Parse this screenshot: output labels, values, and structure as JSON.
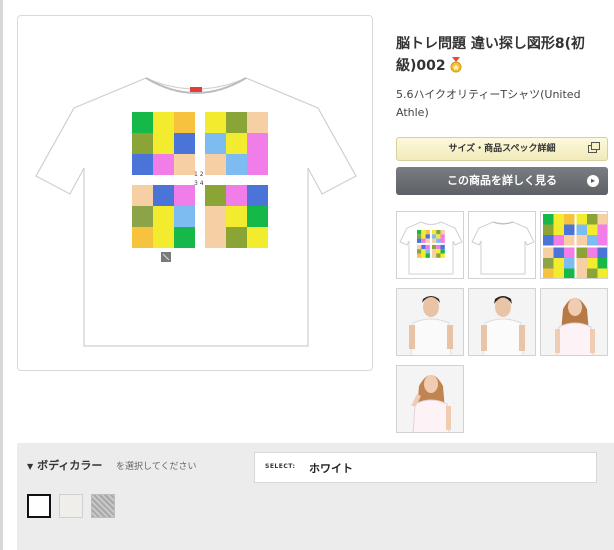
{
  "product": {
    "title": "脳トレ問題 違い探し図形8(初級)002",
    "subtitle": "5.6ハイクオリティーTシャツ(United Athle)"
  },
  "buttons": {
    "spec": "サイズ・商品スペック詳細",
    "detail": "この商品を詳しく見る"
  },
  "design": {
    "numbers_row1": "1 2",
    "numbers_row2": "3 4"
  },
  "thumbnails": [
    {
      "label": "front-design"
    },
    {
      "label": "back-plain"
    },
    {
      "label": "design-closeup"
    },
    {
      "label": "model-male-1"
    },
    {
      "label": "model-male-2"
    },
    {
      "label": "model-female-1"
    },
    {
      "label": "model-female-2"
    }
  ],
  "body_color": {
    "label": "ボディカラー",
    "hint": "を選択してください",
    "select_tag": "SELECT:",
    "selected": "ホワイト",
    "swatches": [
      {
        "name": "white",
        "color": "#ffffff"
      },
      {
        "name": "natural",
        "color": "#efeeea"
      },
      {
        "name": "heather-gray",
        "color": "#b5b5b5"
      }
    ]
  },
  "colors": {
    "green": "#16b84a",
    "yellow": "#f3ec2e",
    "blue": "#4a74d8",
    "pink": "#f07de8",
    "peach": "#f7cfa5",
    "olive": "#8aa535",
    "orange": "#f7c33f",
    "lightblue": "#7dbcf0",
    "khaki": "#8ba448"
  }
}
